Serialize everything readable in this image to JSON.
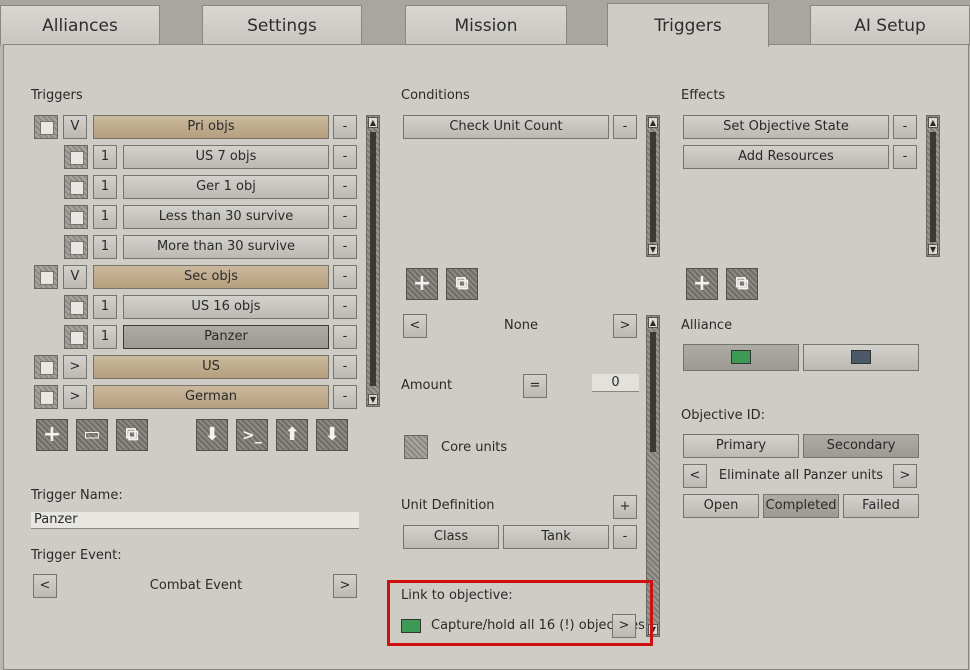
{
  "tabs": [
    "Alliances",
    "Settings",
    "Mission",
    "Triggers",
    "AI Setup"
  ],
  "triggers": {
    "heading": "Triggers",
    "rows": [
      {
        "prefix": "V",
        "label": "Pri objs"
      },
      {
        "prefix": "1",
        "label": "US 7 objs"
      },
      {
        "prefix": "1",
        "label": "Ger 1 obj"
      },
      {
        "prefix": "1",
        "label": "Less than 30 survive"
      },
      {
        "prefix": "1",
        "label": "More than 30 survive"
      },
      {
        "prefix": "V",
        "label": "Sec objs"
      },
      {
        "prefix": "1",
        "label": "US 16 objs"
      },
      {
        "prefix": "1",
        "label": "Panzer"
      },
      {
        "prefix": ">",
        "label": "US"
      },
      {
        "prefix": ">",
        "label": "German"
      }
    ],
    "remove_label": "-",
    "toolbar": [
      "+",
      "▭",
      "⧉",
      "⬇",
      ">_",
      "⬆",
      "⬇"
    ]
  },
  "trigger_name": {
    "label": "Trigger Name:",
    "value": "Panzer"
  },
  "trigger_event": {
    "label": "Trigger Event:",
    "value": "Combat Event",
    "prev": "<",
    "next": ">"
  },
  "conditions": {
    "heading": "Conditions",
    "items": [
      "Check Unit Count"
    ],
    "add": "+",
    "copy": "⧉",
    "selector": {
      "prev": "<",
      "value": "None",
      "next": ">"
    },
    "amount_label": "Amount",
    "operator": "=",
    "amount_value": "0",
    "core_units_label": "Core units",
    "unit_definition_label": "Unit Definition",
    "unit_def_add": "+",
    "unit_def_remove": "-",
    "unit_def_cells": [
      "Class",
      "Tank"
    ],
    "link_label": "Link to objective:",
    "link_value": "Capture/hold all 16 (!) objectives",
    "link_next": ">",
    "link_color": "#3d9a55"
  },
  "effects": {
    "heading": "Effects",
    "items": [
      "Set Objective State",
      "Add Resources"
    ],
    "add": "+",
    "copy": "⧉",
    "alliance_label": "Alliance",
    "alliance_colors": [
      "#3d9a55",
      "#4a5868"
    ],
    "objective_id_label": "Objective ID:",
    "objective_type": [
      "Primary",
      "Secondary"
    ],
    "objective_selector": {
      "prev": "<",
      "value": "Eliminate all Panzer units",
      "next": ">"
    },
    "states": [
      "Open",
      "Completed",
      "Failed"
    ]
  }
}
